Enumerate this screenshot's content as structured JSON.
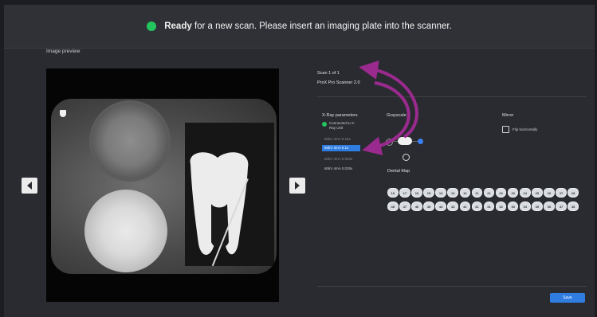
{
  "banner": {
    "status_color": "#22c55e",
    "prefix": "Ready",
    "message": " for a new scan. Please insert an imaging plate into the scanner."
  },
  "preview": {
    "label": "Image preview"
  },
  "scan": {
    "counter": "Scan 1 of 1",
    "device": "ProX Pro Scanner 2.0"
  },
  "xray": {
    "title": "X-Ray parameters",
    "connection": "Connected to X-Ray Unit",
    "options": [
      {
        "label": "60kV 4mA 0.16s",
        "state": "dim"
      },
      {
        "label": "60kV 4mA 0.1s",
        "state": "selected"
      },
      {
        "label": "60kV 4mA 0.063s",
        "state": "dim"
      },
      {
        "label": "60kV 4mA 0.025s",
        "state": "plain"
      }
    ]
  },
  "grayscale": {
    "title": "Grayscale",
    "level": 0.5
  },
  "mirror": {
    "title": "Mirror",
    "checkbox_label": "Flip horizontally",
    "checked": false
  },
  "dental_map": {
    "title": "Dental Map",
    "upper": [
      "18",
      "17",
      "16",
      "15",
      "14",
      "13",
      "12",
      "11",
      "21",
      "22",
      "23",
      "24",
      "25",
      "26",
      "27",
      "28"
    ],
    "lower": [
      "48",
      "47",
      "46",
      "45",
      "44",
      "43",
      "42",
      "41",
      "31",
      "32",
      "33",
      "34",
      "35",
      "36",
      "37",
      "38"
    ]
  },
  "actions": {
    "save": "Save"
  },
  "colors": {
    "accent": "#2f7de1",
    "annotation": "#9b2a8f",
    "ready": "#22c55e"
  },
  "icons": {
    "prev": "chevron-left-icon",
    "next": "chevron-right-icon"
  }
}
